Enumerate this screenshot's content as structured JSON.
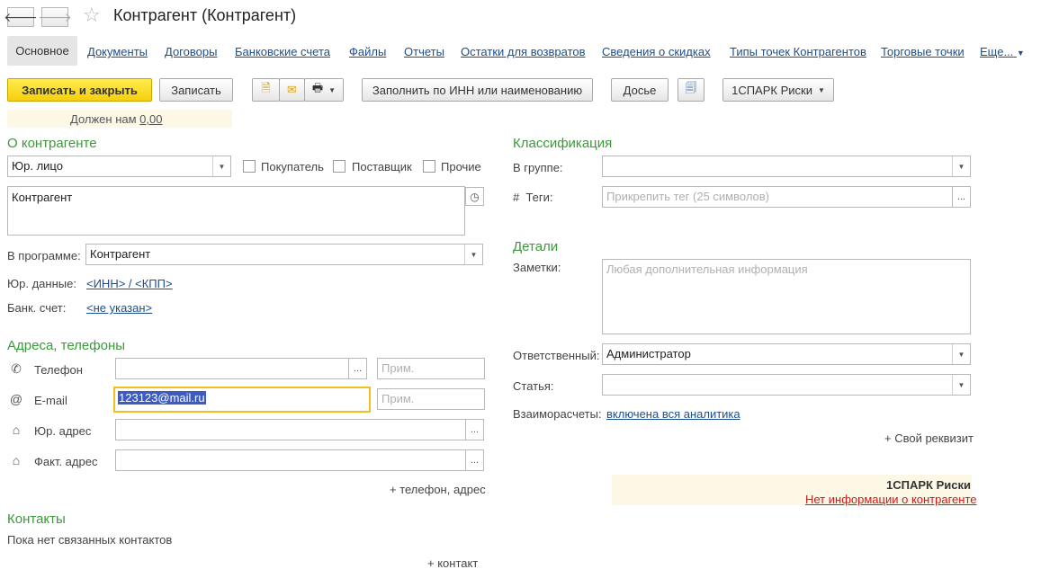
{
  "window": {
    "title": "Контрагент (Контрагент)"
  },
  "tabs": [
    {
      "label": "Основное"
    },
    {
      "label": "Документы"
    },
    {
      "label": "Договоры"
    },
    {
      "label": "Банковские счета"
    },
    {
      "label": "Файлы"
    },
    {
      "label": "Отчеты"
    },
    {
      "label": "Остатки для возвратов"
    },
    {
      "label": "Сведения о скидках"
    },
    {
      "label": "Типы точек Контрагентов"
    },
    {
      "label": "Торговые точки"
    },
    {
      "label": "Еще..."
    }
  ],
  "toolbar": {
    "save_close": "Записать и закрыть",
    "save": "Записать",
    "fill_inn": "Заполнить по ИНН или наименованию",
    "dossier": "Досье",
    "spark": "1СПАРК Риски"
  },
  "debt": {
    "label": "Должен нам",
    "value": "0,00"
  },
  "about": {
    "header": "О контрагенте",
    "type_value": "Юр. лицо",
    "buyer_label": "Покупатель",
    "supplier_label": "Поставщик",
    "other_label": "Прочие",
    "name_value": "Контрагент",
    "in_program_label": "В программе:",
    "in_program_value": "Контрагент",
    "legal_label": "Юр. данные:",
    "legal_link": "<ИНН> / <КПП>",
    "bank_label": "Банк. счет:",
    "bank_link": "<не указан>"
  },
  "addresses": {
    "header": "Адреса, телефоны",
    "phone_label": "Телефон",
    "email_label": "E-mail",
    "email_value": "123123@mail.ru",
    "legal_addr_label": "Юр. адрес",
    "fact_addr_label": "Факт. адрес",
    "note_placeholder": "Прим.",
    "add_link": "+ телефон, адрес"
  },
  "contacts": {
    "header": "Контакты",
    "empty_text": "Пока нет связанных контактов",
    "add_link": "+ контакт"
  },
  "classification": {
    "header": "Классификация",
    "group_label": "В группе:",
    "tags_label": "Теги:",
    "tags_prefix": "#",
    "tags_placeholder": "Прикрепить тег (25 символов)"
  },
  "details": {
    "header": "Детали",
    "notes_label": "Заметки:",
    "notes_placeholder": "Любая дополнительная информация",
    "responsible_label": "Ответственный:",
    "responsible_value": "Администратор",
    "article_label": "Статья:",
    "settlements_label": "Взаиморасчеты:",
    "settlements_link": "включена вся аналитика",
    "own_prop_link": "+ Свой реквизит"
  },
  "spark_panel": {
    "title": "1СПАРК Риски",
    "link": "Нет информации о контрагенте"
  },
  "colors": {
    "section_green": "#3a9a3a",
    "link_blue": "#1c4f8c",
    "primary_yellow": "#f6cf0b",
    "focus_border": "#f0c020",
    "selection": "#3a5cc4",
    "error_red": "#d01818"
  }
}
